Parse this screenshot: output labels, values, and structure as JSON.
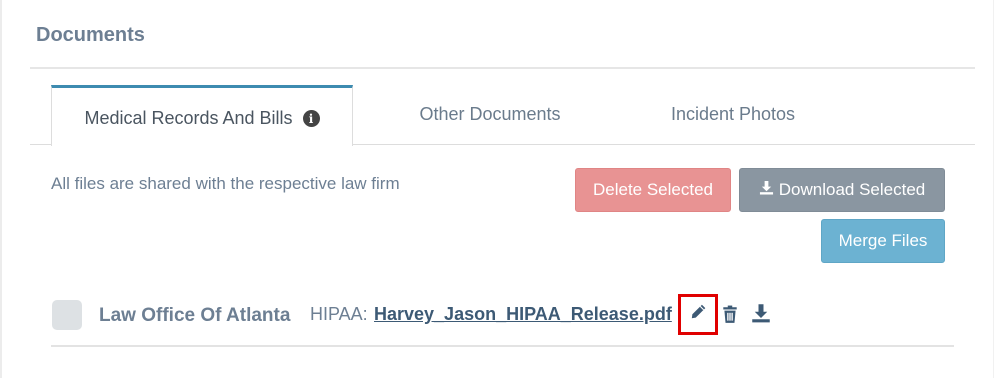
{
  "section": {
    "title": "Documents"
  },
  "tabs": [
    {
      "label": "Medical Records And Bills",
      "active": true
    },
    {
      "label": "Other Documents",
      "active": false
    },
    {
      "label": "Incident Photos",
      "active": false
    }
  ],
  "info_icon_glyph": "i",
  "note": "All files are shared with the respective law firm",
  "actions": {
    "delete_label": "Delete Selected",
    "download_label": "Download Selected",
    "merge_label": "Merge Files"
  },
  "files": [
    {
      "firm": "Law Office Of Atlanta",
      "type_label": "HIPAA:",
      "filename": "Harvey_Jason_HIPAA_Release.pdf",
      "checked": false
    }
  ],
  "icons": {
    "info": "info-circle-icon",
    "download_button": "download-icon",
    "edit": "pencil-icon",
    "delete": "trash-icon",
    "download": "download-icon"
  },
  "colors": {
    "accent": "#3d8bb0",
    "delete": "#e89393",
    "download": "#8a96a1",
    "merge": "#6cb2d2",
    "highlight": "#e00000"
  }
}
